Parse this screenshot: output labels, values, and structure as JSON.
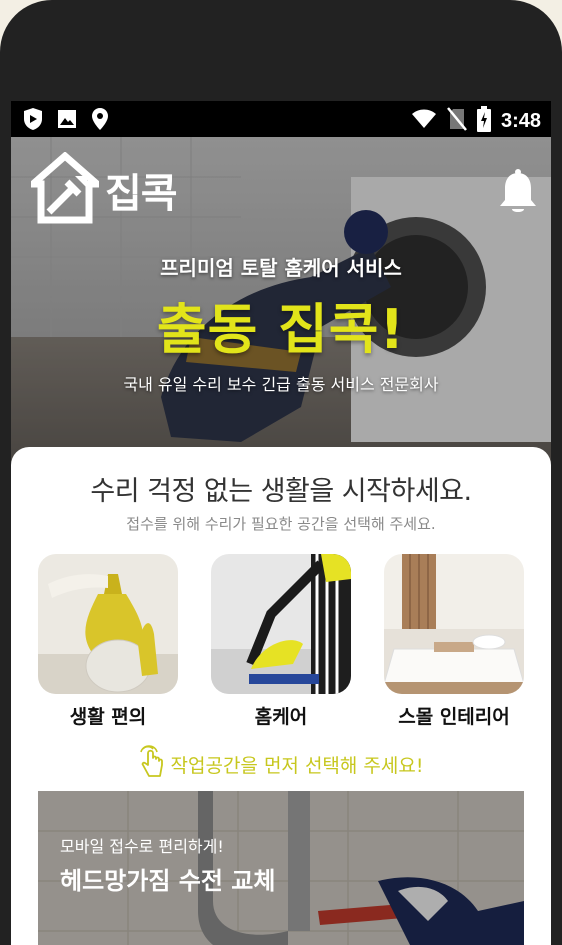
{
  "status_bar": {
    "time": "3:48",
    "icons": [
      "play-protect-icon",
      "gallery-icon",
      "location-icon",
      "wifi-icon",
      "no-sim-icon",
      "battery-icon"
    ]
  },
  "header": {
    "logo_text": "집콕",
    "icons": [
      "logo-house-icon",
      "bell-icon"
    ]
  },
  "hero": {
    "subtitle": "프리미엄 토탈 홈케어 서비스",
    "title": "출동 집콕!",
    "description": "국내 유일 수리 보수 긴급 출동 서비스 전문회사",
    "title_color": "#e2e41a"
  },
  "main": {
    "heading": "수리 걱정 없는 생활을 시작하세요.",
    "subheading": "접수를 위해 수리가 필요한 공간을 선택해 주세요.",
    "spaces": [
      {
        "label": "생활 편의"
      },
      {
        "label": "홈케어"
      },
      {
        "label": "스몰 인테리어"
      }
    ],
    "hint": "작업공간을 먼저 선택해 주세요!",
    "hint_icon": "tap-finger-icon",
    "hint_color": "#c7c71e"
  },
  "banner": {
    "small_text": "모바일 접수로 편리하게!",
    "big_text": "헤드망가짐 수전 교체"
  }
}
